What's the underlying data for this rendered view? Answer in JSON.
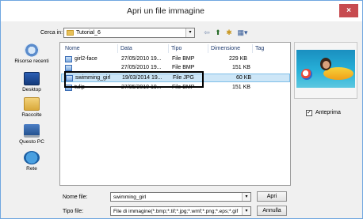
{
  "window": {
    "title": "Apri un file immagine",
    "close_glyph": "×"
  },
  "lookin": {
    "label": "Cerca in:",
    "value": "Tutorial_6",
    "arrow": "▾"
  },
  "toolbar": {
    "back_glyph": "⇦",
    "up_glyph": "⬆",
    "newfolder_glyph": "✱",
    "view_glyph": "▦▾"
  },
  "places": [
    {
      "label": "Risorse recenti",
      "icon": "recent-places-icon"
    },
    {
      "label": "Desktop",
      "icon": "desktop-icon"
    },
    {
      "label": "Raccolte",
      "icon": "libraries-icon"
    },
    {
      "label": "Questo PC",
      "icon": "computer-icon"
    },
    {
      "label": "Rete",
      "icon": "network-icon"
    }
  ],
  "filelist": {
    "columns": [
      "Nome",
      "Data",
      "Tipo",
      "Dimensione",
      "Tag"
    ],
    "rows": [
      {
        "name": "girl2-face",
        "date": "27/05/2010 19...",
        "type": "File BMP",
        "size": "229 KB"
      },
      {
        "name": "",
        "date": "27/05/2010 19...",
        "type": "File BMP",
        "size": "151 KB"
      },
      {
        "name": "swimming_girl",
        "date": "19/03/2014 19...",
        "type": "File JPG",
        "size": "60 KB",
        "selected": true
      },
      {
        "name": "tulip",
        "date": "27/05/2010 19...",
        "type": "File BMP",
        "size": "151 KB"
      }
    ]
  },
  "preview": {
    "checkbox_label": "Anteprima",
    "checked": true,
    "check_glyph": "✓"
  },
  "filename": {
    "label": "Nome file:",
    "value": "swimming_girl"
  },
  "filetype": {
    "label": "Tipo file:",
    "value": "File di immagine(*.bmp;*.tif;*.jpg;*.wmf;*.png;*.eps;*.gif"
  },
  "buttons": {
    "open": "Apri",
    "cancel": "Annulla"
  }
}
